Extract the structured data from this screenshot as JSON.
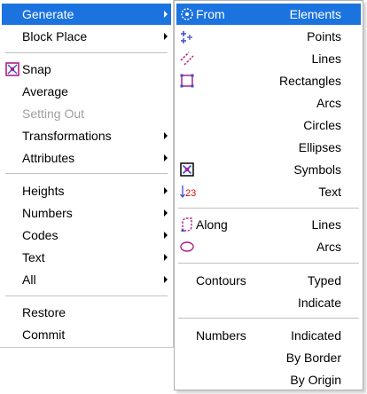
{
  "menu": {
    "generate": "Generate",
    "block_place": "Block Place",
    "snap": "Snap",
    "average": "Average",
    "setting_out": "Setting Out",
    "transformations": "Transformations",
    "attributes": "Attributes",
    "heights": "Heights",
    "numbers": "Numbers",
    "codes": "Codes",
    "text": "Text",
    "all": "All",
    "restore": "Restore",
    "commit": "Commit"
  },
  "submenu": {
    "from": "From",
    "elements": "Elements",
    "points": "Points",
    "lines": "Lines",
    "rectangles": "Rectangles",
    "arcs": "Arcs",
    "circles": "Circles",
    "ellipses": "Ellipses",
    "symbols": "Symbols",
    "text": "Text",
    "text_icon": "23",
    "along": "Along",
    "along_lines": "Lines",
    "along_arcs": "Arcs",
    "contours": "Contours",
    "typed": "Typed",
    "indicate": "Indicate",
    "numbers": "Numbers",
    "indicated": "Indicated",
    "by_border": "By Border",
    "by_origin": "By Origin"
  },
  "colors": {
    "highlight": "#1b73e0",
    "icon_blue": "#3c4cc8",
    "icon_magenta": "#b0208a",
    "icon_red": "#d01010"
  }
}
